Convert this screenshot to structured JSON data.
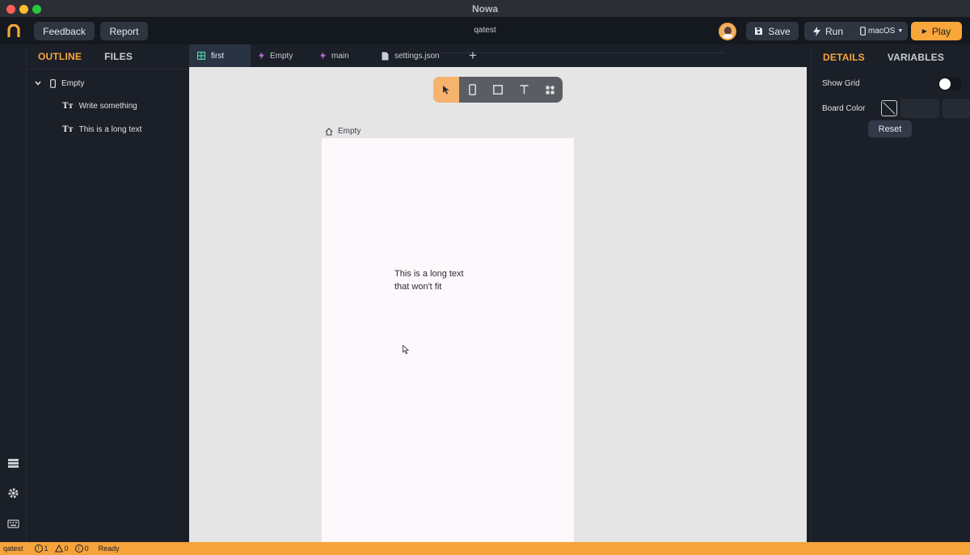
{
  "window": {
    "title": "Nowa"
  },
  "header": {
    "logo_icon": "nowa-logo-icon",
    "feedback_label": "Feedback",
    "report_label": "Report",
    "project_name": "qatest",
    "save_label": "Save",
    "run_label": "Run",
    "platform_label": "macOS",
    "play_label": "Play",
    "accent_color": "#f9a63a"
  },
  "outline_panel": {
    "tabs": [
      {
        "label": "OUTLINE",
        "active": true
      },
      {
        "label": "FILES",
        "active": false
      }
    ],
    "tree": [
      {
        "label": "Empty",
        "icon": "phone-icon",
        "expanded": true,
        "level": 0
      },
      {
        "label": "Write something",
        "icon": "text-tt-icon",
        "level": 1
      },
      {
        "label": "This is a long text",
        "icon": "text-tt-icon",
        "level": 1
      }
    ]
  },
  "editor_tabs": [
    {
      "label": "first",
      "icon": "grid-icon",
      "active": true
    },
    {
      "label": "Empty",
      "icon": "bolt-icon",
      "active": false
    },
    {
      "label": "main",
      "icon": "bolt-icon",
      "active": false
    },
    {
      "label": "settings.json",
      "icon": "file-icon",
      "active": false
    }
  ],
  "canvas": {
    "tools": [
      "pointer-icon",
      "phone-icon",
      "rectangle-icon",
      "text-icon",
      "widgets-icon"
    ],
    "active_tool": "pointer-icon",
    "board_label": "Empty",
    "board_text": "This is a long text that won't fit"
  },
  "details_panel": {
    "tabs": [
      {
        "label": "DETAILS",
        "active": true
      },
      {
        "label": "VARIABLES",
        "active": false
      }
    ],
    "show_grid_label": "Show Grid",
    "show_grid_on": false,
    "board_color_label": "Board Color",
    "reset_label": "Reset"
  },
  "activity_bar": [
    "layers-icon",
    "gear-icon",
    "keyboard-icon"
  ],
  "status_bar": {
    "project": "qatest",
    "errors": "1",
    "warnings": "0",
    "infos": "0",
    "status": "Ready",
    "color": "#f5a33b"
  }
}
